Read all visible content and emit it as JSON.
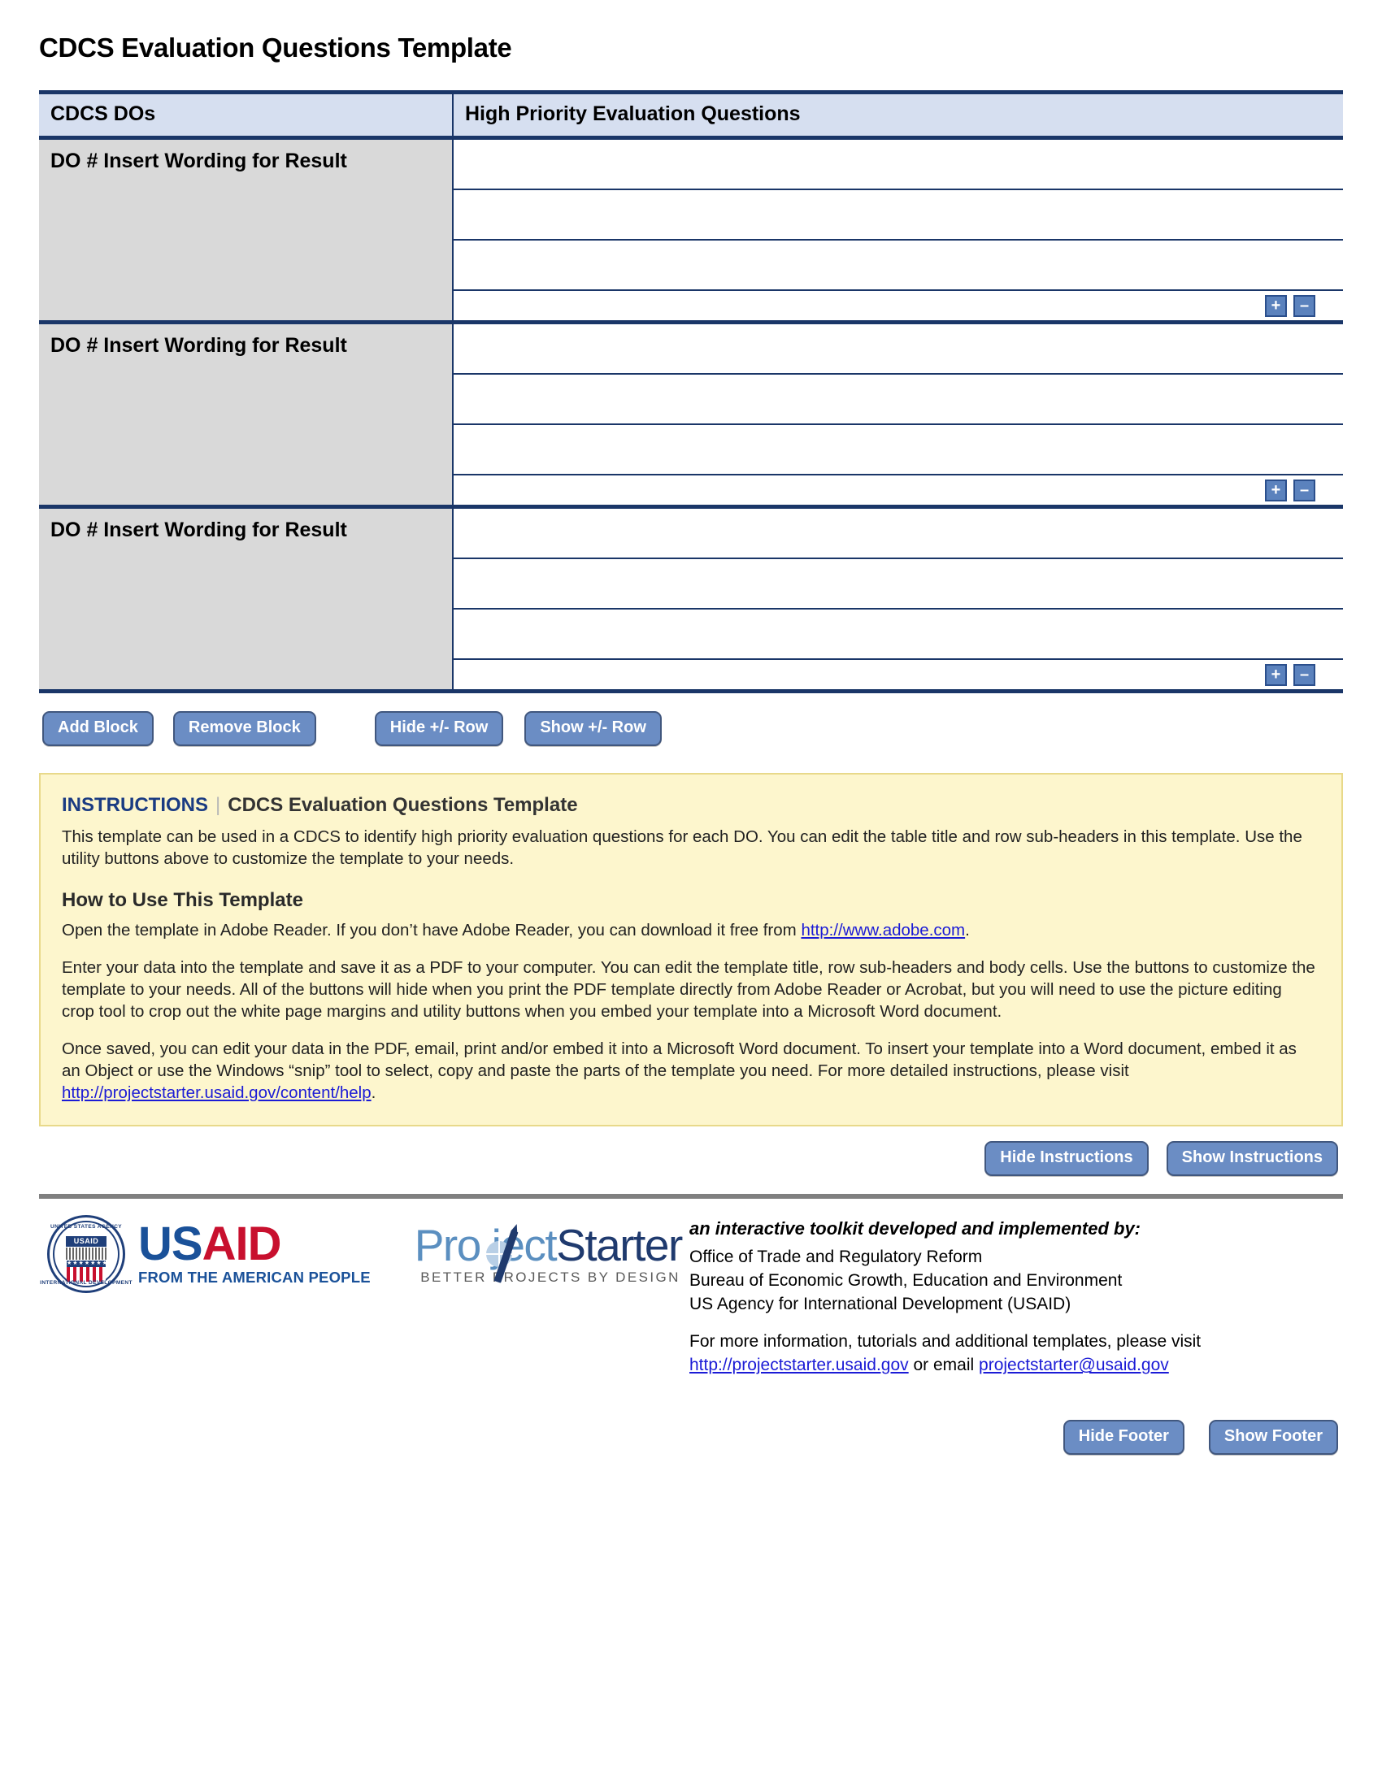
{
  "document": {
    "title": "CDCS Evaluation Questions Template"
  },
  "table": {
    "headers": {
      "left": "CDCS DOs",
      "right": "High Priority Evaluation Questions"
    },
    "row_button_add": "+",
    "row_button_remove": "–",
    "blocks": [
      {
        "do_label": "DO # Insert Wording for Result",
        "question_rows": [
          "",
          "",
          ""
        ]
      },
      {
        "do_label": "DO # Insert Wording for Result",
        "question_rows": [
          "",
          "",
          ""
        ]
      },
      {
        "do_label": "DO # Insert Wording for Result",
        "question_rows": [
          "",
          "",
          ""
        ]
      }
    ]
  },
  "utility_buttons": {
    "add_block": "Add Block",
    "remove_block": "Remove Block",
    "hide_pm_row": "Hide +/- Row",
    "show_pm_row": "Show +/- Row"
  },
  "instructions": {
    "label": "INSTRUCTIONS",
    "separator": "|",
    "subtitle": "CDCS Evaluation Questions Template",
    "intro": "This template can be used in a CDCS to identify high priority evaluation questions for each DO. You can edit the table title and row sub-headers in this template. Use the utility buttons above to customize the template to your needs.",
    "how_to_heading": "How to Use This Template",
    "p1_before_link": "Open the template in Adobe Reader. If you don’t have Adobe Reader, you can download it free from ",
    "p1_link": "http://www.adobe.com",
    "p1_after_link": ".",
    "p2": "Enter your data into the template and save it as a PDF to your computer. You can edit the template title, row sub-headers and body cells. Use the buttons to customize the template to your needs. All of the buttons will hide when you print the PDF template directly from Adobe Reader or Acrobat, but you will need to use the picture editing crop tool to crop out the white page margins and utility buttons when you embed your template into a Microsoft Word document.",
    "p3_before_link": "Once saved, you can edit your data in the PDF, email, print and/or embed it into a Microsoft Word document. To insert your template into a Word document, embed it as an Object or use the Windows “snip” tool to select, copy and paste the parts of the template you need. For more detailed instructions, please visit ",
    "p3_link": "http://projectstarter.usaid.gov/content/help",
    "p3_after_link": ".",
    "hide_button": "Hide Instructions",
    "show_button": "Show Instructions"
  },
  "footer": {
    "usaid_logo": {
      "seal_top_text": "UNITED STATES AGENCY",
      "seal_bottom_text": "INTERNATIONAL DEVELOPMENT",
      "seal_badge": "USAID",
      "seal_stars": "★★★★★★★",
      "word_part1": "US",
      "word_part2": "AID",
      "tagline": "FROM THE AMERICAN PEOPLE"
    },
    "projectstarter_logo": {
      "word_part1": "Pro ject",
      "word_part2": "Starter",
      "tagline": "BETTER PROJECTS BY DESIGN"
    },
    "lead": "an interactive toolkit developed and implemented by:",
    "org_line1": "Office of Trade and Regulatory Reform",
    "org_line2": "Bureau of Economic Growth, Education and Environment",
    "org_line3": "US Agency for International Development (USAID)",
    "contact_before_link1": "For more information, tutorials and additional templates, please visit ",
    "contact_link1": "http://projectstarter.usaid.gov",
    "contact_middle": " or email ",
    "contact_link2": "projectstarter@usaid.gov",
    "hide_button": "Hide Footer",
    "show_button": "Show Footer"
  },
  "colors": {
    "table_border": "#1a3668",
    "header_fill": "#d6dff0",
    "do_cell_fill": "#d9d9d9",
    "button_fill": "#6b8dc4",
    "instructions_fill": "#fdf6cd",
    "link": "#1b1bd6",
    "usaid_blue": "#1a5199",
    "usaid_red": "#c8102e"
  }
}
